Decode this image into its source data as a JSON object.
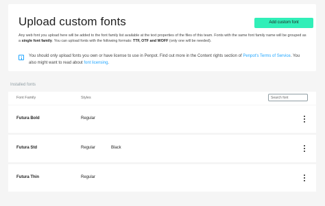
{
  "upload": {
    "title": "Upload custom fonts",
    "add_button": "Add custom font",
    "desc_line1": "Any web font you upload here will be added to the font family list available at the text properties of the files of this team.",
    "desc_line2_pre": "Fonts with the same font family name will be grouped as a ",
    "desc_line2_bold": "single font family",
    "desc_line2_post": ". You can upload fonts with the following formats:",
    "desc_line3_bold": "TTF, OTF and WOFF",
    "desc_line3_post": " (only one will be needed).",
    "notice_pre": "You should only upload fonts you own or have license to use in Penpot. Find out more in the Content rights section of ",
    "notice_link1": "Penpot's Terms of Service",
    "notice_mid": ". You also might want to read about ",
    "notice_link2": "font licensing",
    "notice_post": "."
  },
  "installed": {
    "section_label": "Installed fonts",
    "col_family": "Font Family",
    "col_styles": "Styles",
    "search_placeholder": "Search font",
    "rows": [
      {
        "family": "Futura Bold",
        "styles": [
          "Regular"
        ]
      },
      {
        "family": "Futura Std",
        "styles": [
          "Regular",
          "Black"
        ]
      },
      {
        "family": "Futura Thin",
        "styles": [
          "Regular"
        ]
      }
    ]
  },
  "colors": {
    "accent": "#31efb8",
    "link": "#1fa5ff",
    "background": "#f5f5f5"
  },
  "icons": {
    "info": "info-icon",
    "menu": "more-vertical-icon"
  }
}
